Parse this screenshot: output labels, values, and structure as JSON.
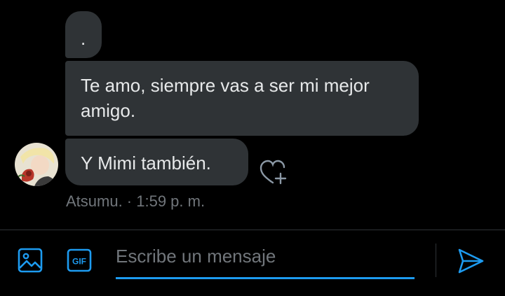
{
  "messages": [
    {
      "text": "."
    },
    {
      "text": "Te amo, siempre vas a ser mi mejor amigo."
    },
    {
      "text": "Y Mimi también."
    }
  ],
  "sender_meta": "Atsumu. · 1:59 p. m.",
  "composer": {
    "placeholder": "Escribe un mensaje",
    "gif_label": "GIF"
  },
  "colors": {
    "background": "#000000",
    "bubble": "#2f3336",
    "accent": "#1d9bf0",
    "muted_text": "#71767b"
  },
  "icons": [
    "heart-plus-icon",
    "image-icon",
    "gif-icon",
    "send-icon"
  ]
}
